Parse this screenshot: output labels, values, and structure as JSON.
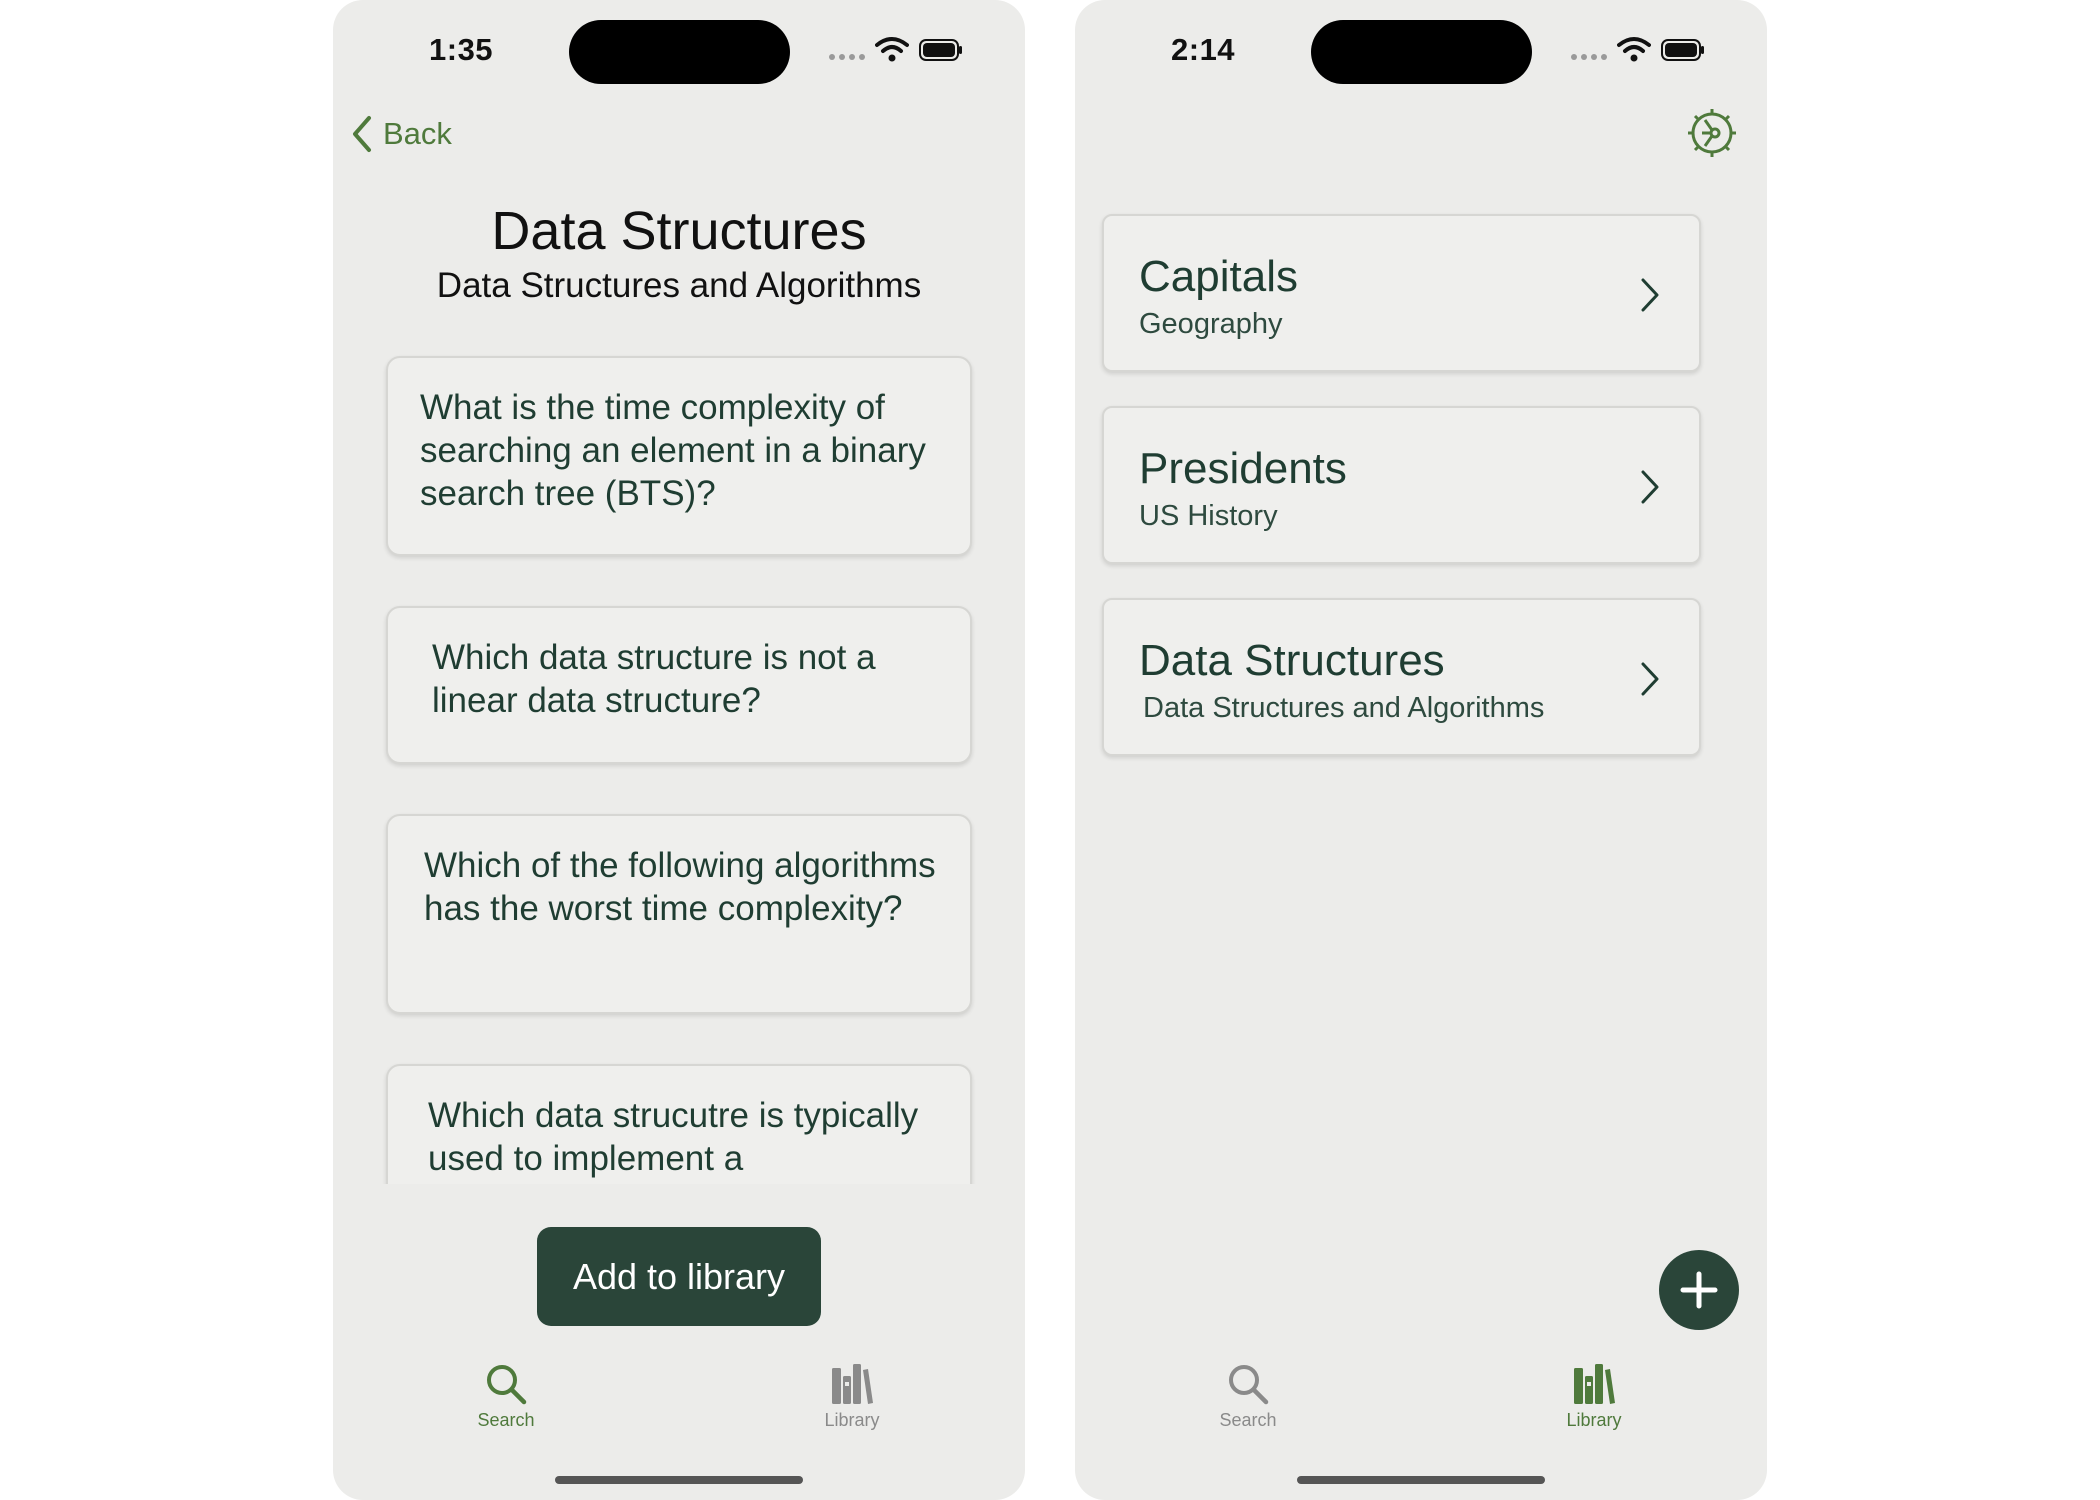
{
  "left_screen": {
    "status": {
      "time": "1:35"
    },
    "back_label": "Back",
    "title": "Data Structures",
    "subtitle": "Data Structures and Algorithms",
    "questions": [
      "What is the time complexity of searching an element in a binary search tree (BTS)?",
      "Which data structure is not a linear data structure?",
      "Which of the following algorithms has the worst time complexity?",
      "Which data strucutre is typically used to implement a"
    ],
    "add_button_label": "Add to library",
    "tabs": [
      {
        "label": "Search",
        "icon": "search-icon",
        "active": true
      },
      {
        "label": "Library",
        "icon": "library-icon",
        "active": false
      }
    ]
  },
  "right_screen": {
    "status": {
      "time": "2:14"
    },
    "settings_icon": "settings-gear-icon",
    "decks": [
      {
        "title": "Capitals",
        "subject": "Geography"
      },
      {
        "title": "Presidents",
        "subject": "US History"
      },
      {
        "title": "Data Structures",
        "subject": "Data Structures and Algorithms"
      }
    ],
    "fab_icon": "plus-icon",
    "tabs": [
      {
        "label": "Search",
        "icon": "search-icon",
        "active": false
      },
      {
        "label": "Library",
        "icon": "library-icon",
        "active": true
      }
    ]
  },
  "colors": {
    "background": "#ececea",
    "accent_green": "#4f7a3c",
    "dark_green": "#2a4539",
    "text_green": "#1f3d32",
    "inactive_gray": "#8a8a8a"
  }
}
